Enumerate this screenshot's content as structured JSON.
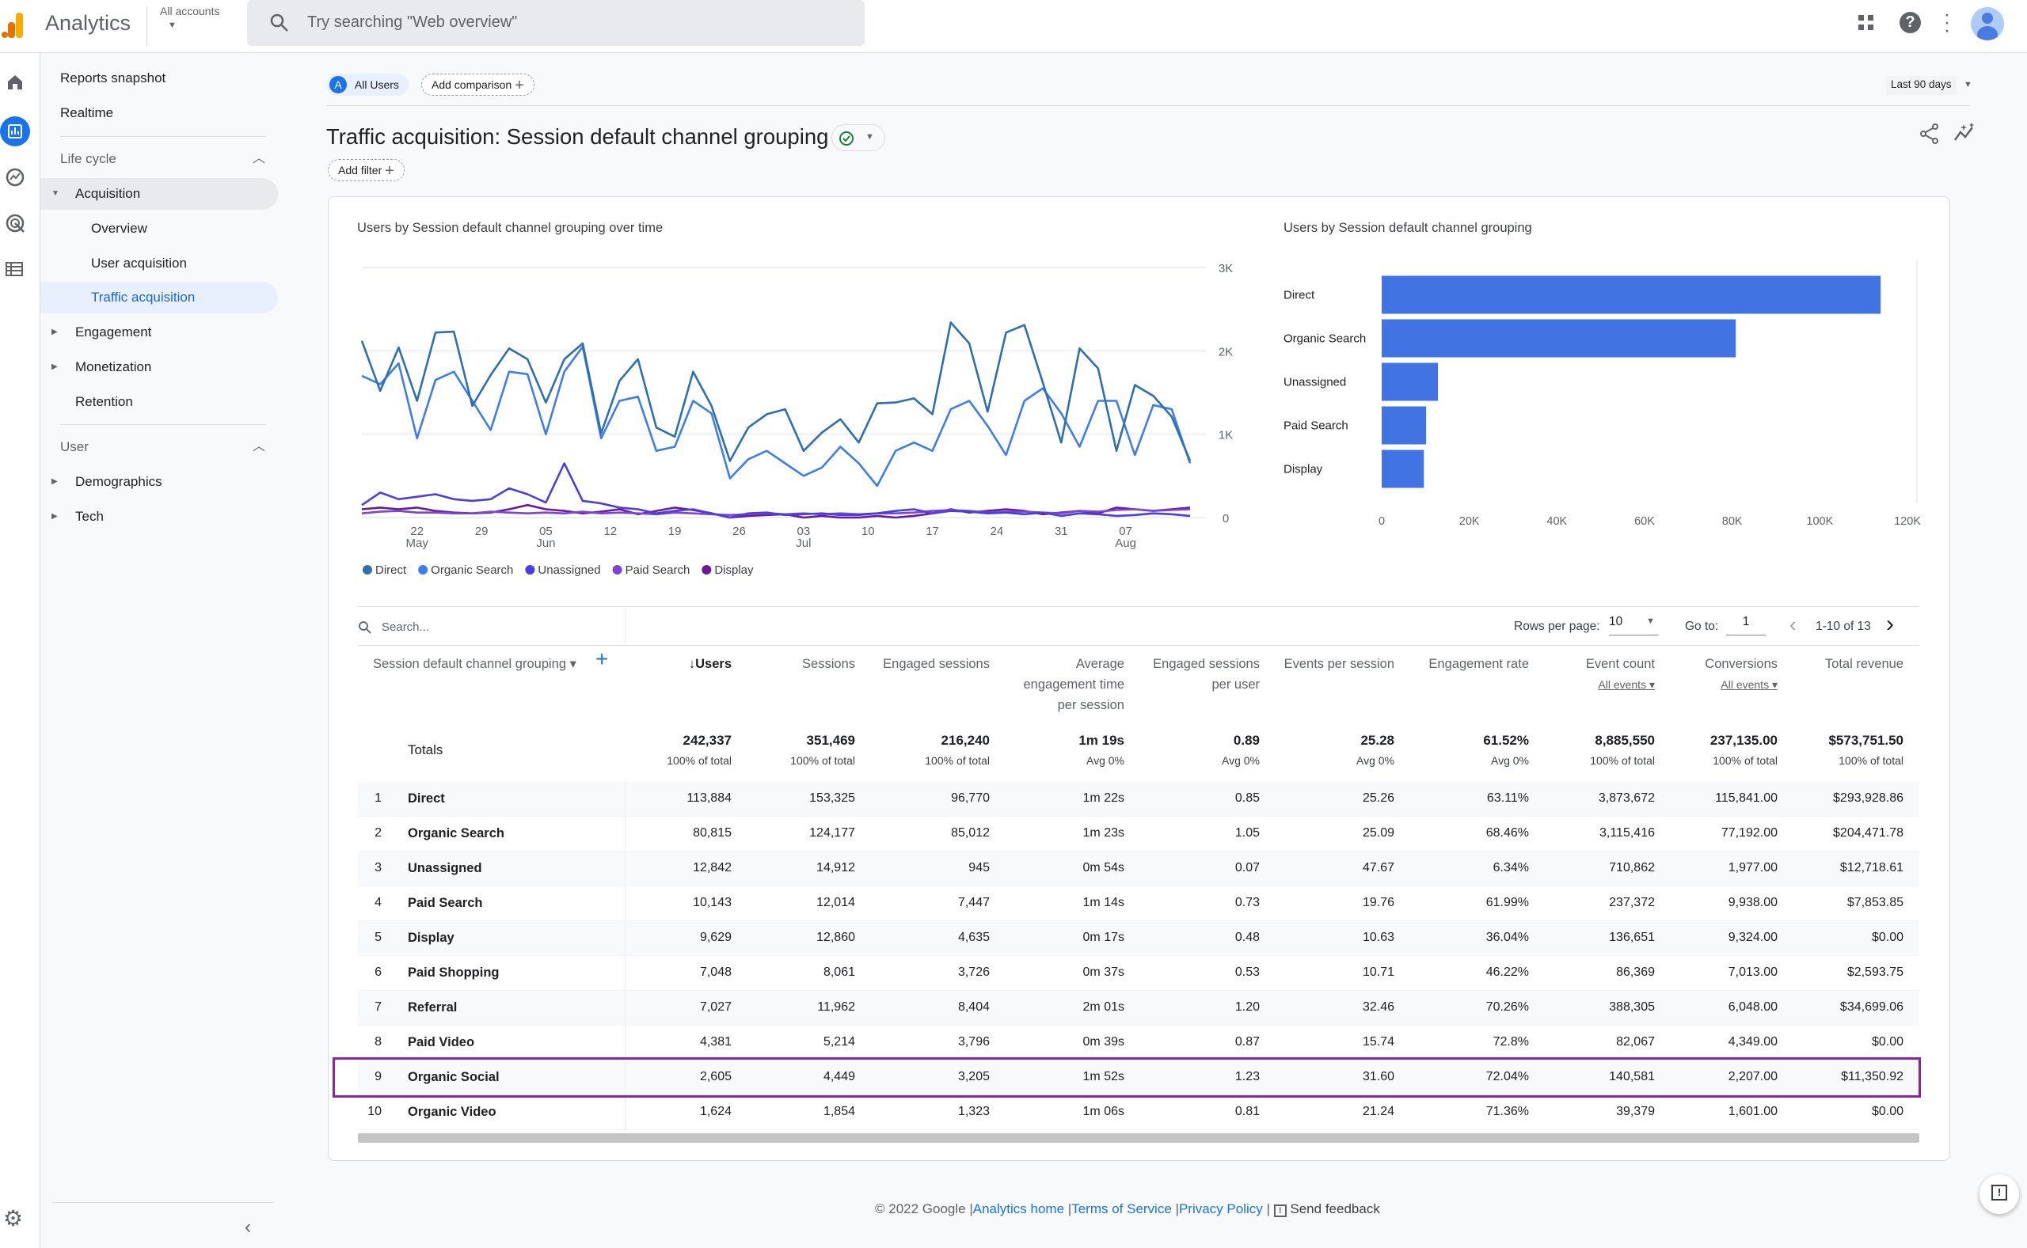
{
  "app": {
    "title": "Analytics",
    "account_label": "All accounts",
    "search_placeholder": "Try searching \"Web overview\""
  },
  "sidebar": {
    "items": [
      {
        "label": "Reports snapshot"
      },
      {
        "label": "Realtime"
      }
    ],
    "lifecycle": {
      "label": "Life cycle",
      "items": [
        {
          "label": "Acquisition",
          "expanded": true
        },
        {
          "label": "Overview"
        },
        {
          "label": "User acquisition"
        },
        {
          "label": "Traffic acquisition",
          "selected": true
        },
        {
          "label": "Engagement"
        },
        {
          "label": "Monetization"
        },
        {
          "label": "Retention"
        }
      ]
    },
    "user": {
      "label": "User",
      "items": [
        {
          "label": "Demographics"
        },
        {
          "label": "Tech"
        }
      ]
    }
  },
  "comparison": {
    "segment_badge": "A",
    "segment": "All Users",
    "add_comparison": "Add comparison",
    "date_range": "Last 90 days"
  },
  "report": {
    "title": "Traffic acquisition: Session default channel grouping",
    "add_filter": "Add filter"
  },
  "colors": {
    "accent": "#1a73e8",
    "direct": "#2f6fae",
    "organic_search": "#3f7ee8",
    "unassigned": "#4a3ee0",
    "paid_search": "#7a45d6",
    "display": "#6a1b9a",
    "bar": "#4273e3",
    "highlight": "#8e24aa"
  },
  "chart_data": [
    {
      "type": "line",
      "title": "Users by Session default channel grouping over time",
      "x": [
        "May 16",
        "May 18",
        "May 20",
        "May 22",
        "May 24",
        "May 26",
        "May 28",
        "May 30",
        "Jun 1",
        "Jun 3",
        "Jun 5",
        "Jun 7",
        "Jun 9",
        "Jun 11",
        "Jun 13",
        "Jun 15",
        "Jun 17",
        "Jun 19",
        "Jun 21",
        "Jun 23",
        "Jun 25",
        "Jun 27",
        "Jun 29",
        "Jul 1",
        "Jul 3",
        "Jul 5",
        "Jul 7",
        "Jul 9",
        "Jul 11",
        "Jul 13",
        "Jul 15",
        "Jul 17",
        "Jul 19",
        "Jul 21",
        "Jul 23",
        "Jul 25",
        "Jul 27",
        "Jul 29",
        "Jul 31",
        "Aug 2",
        "Aug 4",
        "Aug 6",
        "Aug 8",
        "Aug 10",
        "Aug 12",
        "Aug 14"
      ],
      "series": [
        {
          "name": "Direct",
          "values": [
            2120,
            1520,
            2040,
            1400,
            2220,
            2230,
            1340,
            1710,
            2030,
            1900,
            1380,
            1900,
            2090,
            1010,
            1640,
            1900,
            1080,
            970,
            1750,
            1340,
            680,
            1080,
            1240,
            1300,
            800,
            1020,
            1180,
            900,
            1370,
            1380,
            1430,
            1240,
            2340,
            2090,
            1270,
            2220,
            2310,
            1620,
            900,
            2030,
            1790,
            800,
            1590,
            1460,
            1210,
            680
          ]
        },
        {
          "name": "Organic Search",
          "values": [
            1700,
            1600,
            1850,
            950,
            1650,
            1750,
            1400,
            1050,
            1750,
            1720,
            1000,
            1750,
            2050,
            950,
            1400,
            1450,
            800,
            850,
            1400,
            1250,
            470,
            700,
            800,
            650,
            500,
            600,
            850,
            650,
            380,
            800,
            900,
            800,
            1300,
            1400,
            1100,
            750,
            1400,
            1550,
            1250,
            850,
            1400,
            1400,
            750,
            1350,
            1300,
            650
          ]
        },
        {
          "name": "Unassigned",
          "values": [
            150,
            300,
            220,
            250,
            280,
            220,
            200,
            220,
            350,
            280,
            180,
            650,
            200,
            170,
            120,
            100,
            50,
            80,
            100,
            50,
            0,
            50,
            60,
            30,
            40,
            50,
            30,
            30,
            50,
            80,
            100,
            50,
            80,
            70,
            50,
            60,
            40,
            60,
            20,
            50,
            40,
            20,
            30,
            50,
            40,
            20
          ]
        },
        {
          "name": "Paid Search",
          "values": [
            50,
            70,
            80,
            60,
            60,
            50,
            50,
            70,
            60,
            50,
            60,
            50,
            70,
            50,
            60,
            50,
            40,
            60,
            50,
            40,
            30,
            40,
            50,
            40,
            50,
            40,
            50,
            40,
            50,
            50,
            60,
            80,
            90,
            80,
            60,
            70,
            70,
            60,
            50,
            80,
            70,
            90,
            100,
            80,
            90,
            100
          ]
        },
        {
          "name": "Display",
          "values": [
            100,
            120,
            100,
            120,
            80,
            60,
            50,
            60,
            100,
            150,
            100,
            80,
            50,
            70,
            100,
            40,
            80,
            120,
            90,
            50,
            0,
            20,
            30,
            40,
            0,
            20,
            0,
            0,
            20,
            0,
            20,
            50,
            100,
            60,
            80,
            100,
            80,
            40,
            60,
            80,
            50,
            120,
            100,
            80,
            100,
            120
          ]
        }
      ],
      "ylim": [
        0,
        3000
      ],
      "yticks": [
        "0",
        "1K",
        "2K",
        "3K"
      ],
      "xticks": [
        {
          "date": "May 22",
          "label": "22",
          "sub": "May"
        },
        {
          "date": "May 29",
          "label": "29",
          "sub": ""
        },
        {
          "date": "Jun 5",
          "label": "05",
          "sub": "Jun"
        },
        {
          "date": "Jun 12",
          "label": "12",
          "sub": ""
        },
        {
          "date": "Jun 19",
          "label": "19",
          "sub": ""
        },
        {
          "date": "Jun 26",
          "label": "26",
          "sub": ""
        },
        {
          "date": "Jul 3",
          "label": "03",
          "sub": "Jul"
        },
        {
          "date": "Jul 10",
          "label": "10",
          "sub": ""
        },
        {
          "date": "Jul 17",
          "label": "17",
          "sub": ""
        },
        {
          "date": "Jul 24",
          "label": "24",
          "sub": ""
        },
        {
          "date": "Jul 31",
          "label": "31",
          "sub": ""
        },
        {
          "date": "Aug 7",
          "label": "07",
          "sub": "Aug"
        }
      ],
      "grid": true,
      "legend": "bottom-left"
    },
    {
      "type": "bar",
      "orientation": "horizontal",
      "title": "Users by Session default channel grouping",
      "categories": [
        "Direct",
        "Organic Search",
        "Unassigned",
        "Paid Search",
        "Display"
      ],
      "values": [
        113884,
        80815,
        12842,
        10143,
        9629
      ],
      "xlim": [
        0,
        120000
      ],
      "xticks": [
        "0",
        "20K",
        "40K",
        "60K",
        "80K",
        "100K",
        "120K"
      ]
    }
  ],
  "table": {
    "search_placeholder": "Search...",
    "rows_per_page_label": "Rows per page:",
    "rows_per_page": "10",
    "goto_label": "Go to:",
    "goto_value": "1",
    "range": "1-10 of 13",
    "dimension_header": "Session default channel grouping",
    "columns": [
      {
        "label": "↓Users",
        "sorted": true
      },
      {
        "label": "Sessions"
      },
      {
        "label": "Engaged sessions"
      },
      {
        "label": "Average engagement time per session"
      },
      {
        "label": "Engaged sessions per user"
      },
      {
        "label": "Events per session"
      },
      {
        "label": "Engagement rate"
      },
      {
        "label": "Event count",
        "sub": "All events"
      },
      {
        "label": "Conversions",
        "sub": "All events"
      },
      {
        "label": "Total revenue"
      }
    ],
    "totals": {
      "label": "Totals",
      "values": [
        "242,337",
        "351,469",
        "216,240",
        "1m 19s",
        "0.89",
        "25.28",
        "61.52%",
        "8,885,550",
        "237,135.00",
        "$573,751.50"
      ],
      "subs": [
        "100% of total",
        "100% of total",
        "100% of total",
        "Avg 0%",
        "Avg 0%",
        "Avg 0%",
        "Avg 0%",
        "100% of total",
        "100% of total",
        "100% of total"
      ]
    },
    "rows": [
      {
        "rank": "1",
        "name": "Direct",
        "values": [
          "113,884",
          "153,325",
          "96,770",
          "1m 22s",
          "0.85",
          "25.26",
          "63.11%",
          "3,873,672",
          "115,841.00",
          "$293,928.86"
        ]
      },
      {
        "rank": "2",
        "name": "Organic Search",
        "values": [
          "80,815",
          "124,177",
          "85,012",
          "1m 23s",
          "1.05",
          "25.09",
          "68.46%",
          "3,115,416",
          "77,192.00",
          "$204,471.78"
        ]
      },
      {
        "rank": "3",
        "name": "Unassigned",
        "values": [
          "12,842",
          "14,912",
          "945",
          "0m 54s",
          "0.07",
          "47.67",
          "6.34%",
          "710,862",
          "1,977.00",
          "$12,718.61"
        ]
      },
      {
        "rank": "4",
        "name": "Paid Search",
        "values": [
          "10,143",
          "12,014",
          "7,447",
          "1m 14s",
          "0.73",
          "19.76",
          "61.99%",
          "237,372",
          "9,938.00",
          "$7,853.85"
        ]
      },
      {
        "rank": "5",
        "name": "Display",
        "values": [
          "9,629",
          "12,860",
          "4,635",
          "0m 17s",
          "0.48",
          "10.63",
          "36.04%",
          "136,651",
          "9,324.00",
          "$0.00"
        ]
      },
      {
        "rank": "6",
        "name": "Paid Shopping",
        "values": [
          "7,048",
          "8,061",
          "3,726",
          "0m 37s",
          "0.53",
          "10.71",
          "46.22%",
          "86,369",
          "7,013.00",
          "$2,593.75"
        ]
      },
      {
        "rank": "7",
        "name": "Referral",
        "values": [
          "7,027",
          "11,962",
          "8,404",
          "2m 01s",
          "1.20",
          "32.46",
          "70.26%",
          "388,305",
          "6,048.00",
          "$34,699.06"
        ]
      },
      {
        "rank": "8",
        "name": "Paid Video",
        "values": [
          "4,381",
          "5,214",
          "3,796",
          "0m 39s",
          "0.87",
          "15.74",
          "72.8%",
          "82,067",
          "4,349.00",
          "$0.00"
        ]
      },
      {
        "rank": "9",
        "name": "Organic Social",
        "highlighted": true,
        "values": [
          "2,605",
          "4,449",
          "3,205",
          "1m 52s",
          "1.23",
          "31.60",
          "72.04%",
          "140,581",
          "2,207.00",
          "$11,350.92"
        ]
      },
      {
        "rank": "10",
        "name": "Organic Video",
        "values": [
          "1,624",
          "1,854",
          "1,323",
          "1m 06s",
          "0.81",
          "21.24",
          "71.36%",
          "39,379",
          "1,601.00",
          "$0.00"
        ]
      }
    ]
  },
  "footer": {
    "copyright": "© 2022 Google",
    "sep": "|",
    "analytics_home": "Analytics home",
    "terms": "Terms of Service",
    "privacy": "Privacy Policy",
    "feedback": "Send feedback"
  }
}
